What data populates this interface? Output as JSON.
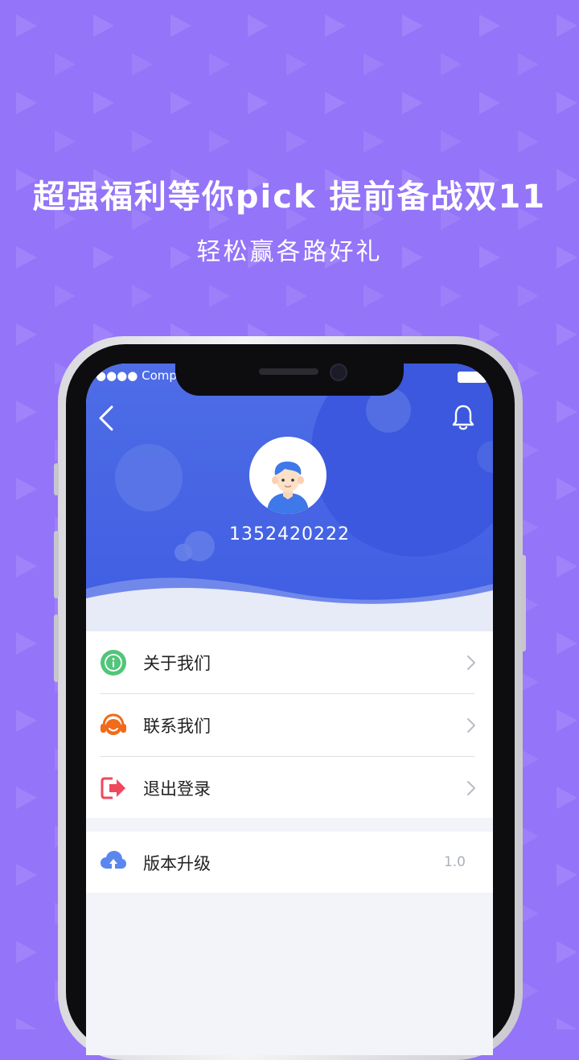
{
  "promo": {
    "title": "超强福利等你pick 提前备战双11",
    "subtitle": "轻松赢各路好礼"
  },
  "status_bar": {
    "carrier": "●●●● Compar"
  },
  "header": {
    "back_icon": "chevron-left-icon",
    "bell_icon": "bell-icon",
    "phone_number": "1352420222"
  },
  "menu": {
    "items": [
      {
        "label": "关于我们",
        "icon": "info-icon"
      },
      {
        "label": "联系我们",
        "icon": "headset-icon"
      },
      {
        "label": "退出登录",
        "icon": "logout-icon"
      }
    ],
    "upgrade": {
      "label": "版本升级",
      "version": "1.0",
      "icon": "cloud-upload-icon"
    }
  },
  "colors": {
    "background": "#9474f8",
    "header_blue": "#4e6de6",
    "info_green": "#52c57a",
    "headset_orange": "#f06b1a",
    "logout_red": "#f0475c",
    "cloud_blue": "#5a87ef"
  }
}
